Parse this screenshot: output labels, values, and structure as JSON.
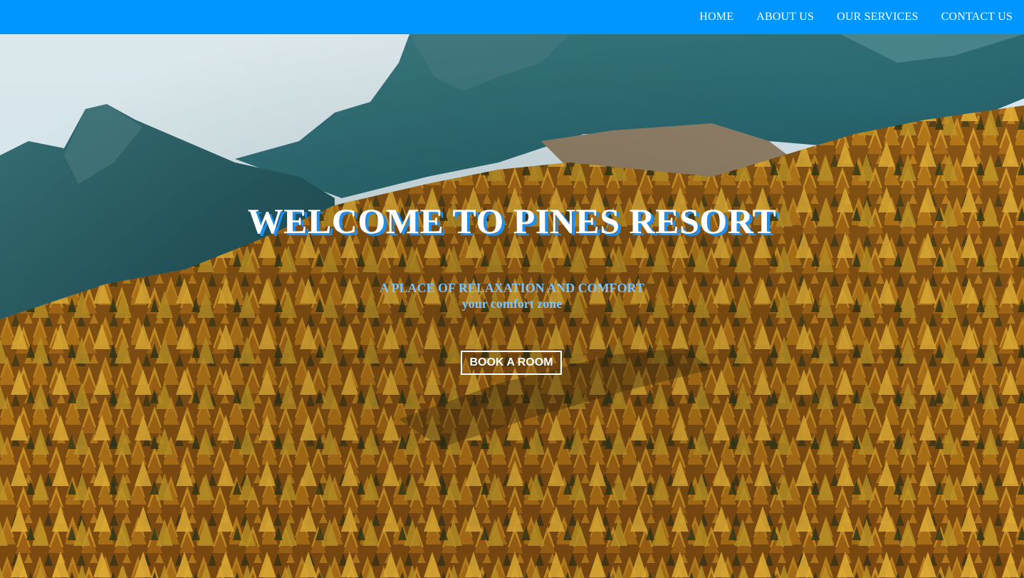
{
  "nav": {
    "items": [
      {
        "label": "HOME"
      },
      {
        "label": "ABOUT US"
      },
      {
        "label": "OUR SERVICES"
      },
      {
        "label": "CONTACT US"
      }
    ],
    "background_color": "#0096ff"
  },
  "hero": {
    "title": "WELCOME TO PINES RESORT",
    "tagline": "A PLACE OF RELAXATION AND COMFORT",
    "subtagline": "your comfort zone",
    "cta_label": "BOOK A ROOM",
    "title_shadow_color": "#1c8ff0",
    "tagline_color": "#7cc4ff"
  }
}
